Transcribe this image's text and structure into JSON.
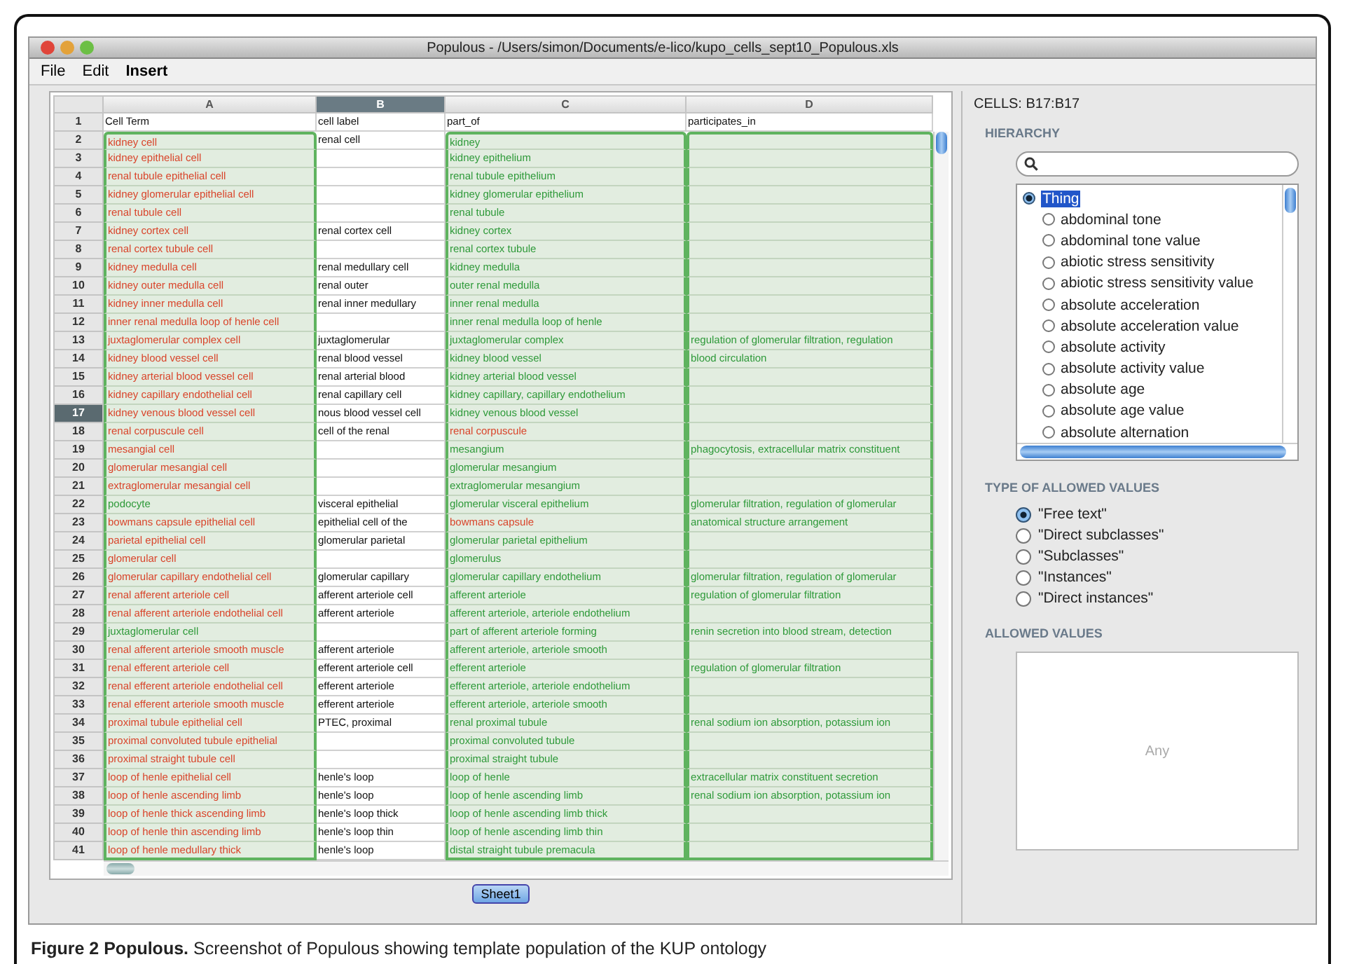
{
  "window": {
    "title": "Populous - /Users/simon/Documents/e-lico/kupo_cells_sept10_Populous.xls"
  },
  "menu": [
    "File",
    "Edit",
    "Insert"
  ],
  "table": {
    "columns": [
      {
        "label": "A",
        "selected": false,
        "highlighted": true
      },
      {
        "label": "B",
        "selected": true,
        "highlighted": false
      },
      {
        "label": "C",
        "selected": false,
        "highlighted": true
      },
      {
        "label": "D",
        "selected": false,
        "highlighted": true
      }
    ],
    "header_row": {
      "number": "1",
      "cells": [
        {
          "text": "Cell Term"
        },
        {
          "text": "cell label"
        },
        {
          "text": "part_of"
        },
        {
          "text": "participates_in"
        }
      ]
    },
    "rows": [
      {
        "number": "2",
        "selected": false,
        "cells": [
          {
            "text": "kidney cell",
            "color": "#d9452b"
          },
          {
            "text": "renal cell"
          },
          {
            "text": "kidney",
            "color": "#2f9a3a"
          },
          null
        ]
      },
      {
        "number": "3",
        "selected": false,
        "cells": [
          {
            "text": "kidney epithelial cell",
            "color": "#d9452b"
          },
          null,
          {
            "text": "kidney epithelium",
            "color": "#2f9a3a"
          },
          null
        ]
      },
      {
        "number": "4",
        "selected": false,
        "cells": [
          {
            "text": "renal tubule epithelial cell",
            "color": "#d9452b"
          },
          null,
          {
            "text": "renal tubule epithelium",
            "color": "#2f9a3a"
          },
          null
        ]
      },
      {
        "number": "5",
        "selected": false,
        "cells": [
          {
            "text": "kidney glomerular epithelial cell",
            "color": "#d9452b"
          },
          null,
          {
            "text": "kidney glomerular epithelium",
            "color": "#2f9a3a"
          },
          null
        ]
      },
      {
        "number": "6",
        "selected": false,
        "cells": [
          {
            "text": "renal tubule cell",
            "color": "#d9452b"
          },
          null,
          {
            "text": "renal tubule",
            "color": "#2f9a3a"
          },
          null
        ]
      },
      {
        "number": "7",
        "selected": false,
        "cells": [
          {
            "text": "kidney cortex cell",
            "color": "#d9452b"
          },
          {
            "text": "renal cortex cell"
          },
          {
            "text": "kidney cortex",
            "color": "#2f9a3a"
          },
          null
        ]
      },
      {
        "number": "8",
        "selected": false,
        "cells": [
          {
            "text": "renal cortex tubule cell",
            "color": "#d9452b"
          },
          null,
          {
            "text": "renal cortex tubule",
            "color": "#2f9a3a"
          },
          null
        ]
      },
      {
        "number": "9",
        "selected": false,
        "cells": [
          {
            "text": "kidney medulla cell",
            "color": "#d9452b"
          },
          {
            "text": "renal medullary cell"
          },
          {
            "text": "kidney medulla",
            "color": "#2f9a3a"
          },
          null
        ]
      },
      {
        "number": "10",
        "selected": false,
        "cells": [
          {
            "text": "kidney outer medulla cell",
            "color": "#d9452b"
          },
          {
            "text": "renal outer"
          },
          {
            "text": "outer renal medulla",
            "color": "#2f9a3a"
          },
          null
        ]
      },
      {
        "number": "11",
        "selected": false,
        "cells": [
          {
            "text": "kidney inner medulla cell",
            "color": "#d9452b"
          },
          {
            "text": "renal inner medullary"
          },
          {
            "text": "inner renal medulla",
            "color": "#2f9a3a"
          },
          null
        ]
      },
      {
        "number": "12",
        "selected": false,
        "cells": [
          {
            "text": "inner renal medulla loop of henle cell",
            "color": "#d9452b"
          },
          null,
          {
            "text": "inner renal medulla loop of henle",
            "color": "#2f9a3a"
          },
          null
        ]
      },
      {
        "number": "13",
        "selected": false,
        "cells": [
          {
            "text": "juxtaglomerular complex cell",
            "color": "#d9452b"
          },
          {
            "text": "juxtaglomerular"
          },
          {
            "text": "juxtaglomerular complex",
            "color": "#2f9a3a"
          },
          {
            "text": "regulation of glomerular filtration, regulation",
            "color": "#2f9a3a"
          }
        ]
      },
      {
        "number": "14",
        "selected": false,
        "cells": [
          {
            "text": "kidney blood vessel cell",
            "color": "#d9452b"
          },
          {
            "text": "renal blood vessel"
          },
          {
            "text": "kidney blood vessel",
            "color": "#2f9a3a"
          },
          {
            "text": "blood circulation",
            "color": "#2f9a3a"
          }
        ]
      },
      {
        "number": "15",
        "selected": false,
        "cells": [
          {
            "text": "kidney arterial blood vessel cell",
            "color": "#d9452b"
          },
          {
            "text": "renal arterial blood"
          },
          {
            "text": "kidney arterial blood vessel",
            "color": "#2f9a3a"
          },
          null
        ]
      },
      {
        "number": "16",
        "selected": false,
        "cells": [
          {
            "text": "kidney capillary endothelial cell",
            "color": "#d9452b"
          },
          {
            "text": "renal capillary cell"
          },
          {
            "text": "kidney capillary, capillary endothelium",
            "color": "#2f9a3a"
          },
          null
        ]
      },
      {
        "number": "17",
        "selected": true,
        "cells": [
          {
            "text": "kidney venous blood vessel cell",
            "color": "#d9452b"
          },
          {
            "text": "nous blood vessel cell"
          },
          {
            "text": "kidney venous blood vessel",
            "color": "#2f9a3a"
          },
          null
        ]
      },
      {
        "number": "18",
        "selected": false,
        "cells": [
          {
            "text": "renal corpuscule cell",
            "color": "#d9452b"
          },
          {
            "text": "cell of the renal"
          },
          {
            "text": "renal corpuscule",
            "color": "#d9452b"
          },
          null
        ]
      },
      {
        "number": "19",
        "selected": false,
        "cells": [
          {
            "text": "mesangial cell",
            "color": "#d9452b"
          },
          null,
          {
            "text": "mesangium",
            "color": "#2f9a3a"
          },
          {
            "text": "phagocytosis, extracellular matrix constituent",
            "color": "#2f9a3a"
          }
        ]
      },
      {
        "number": "20",
        "selected": false,
        "cells": [
          {
            "text": "glomerular mesangial cell",
            "color": "#d9452b"
          },
          null,
          {
            "text": "glomerular mesangium",
            "color": "#2f9a3a"
          },
          null
        ]
      },
      {
        "number": "21",
        "selected": false,
        "cells": [
          {
            "text": "extraglomerular mesangial cell",
            "color": "#d9452b"
          },
          null,
          {
            "text": "extraglomerular mesangium",
            "color": "#2f9a3a"
          },
          null
        ]
      },
      {
        "number": "22",
        "selected": false,
        "cells": [
          {
            "text": "podocyte",
            "color": "#2f9a3a"
          },
          {
            "text": "visceral epithelial"
          },
          {
            "text": "glomerular visceral epithelium",
            "color": "#2f9a3a"
          },
          {
            "text": "glomerular filtration, regulation of glomerular",
            "color": "#2f9a3a"
          }
        ]
      },
      {
        "number": "23",
        "selected": false,
        "cells": [
          {
            "text": "bowmans capsule epithelial cell",
            "color": "#d9452b"
          },
          {
            "text": "epithelial cell of the"
          },
          {
            "text": "bowmans capsule",
            "color": "#d9452b"
          },
          {
            "text": "anatomical structure arrangement",
            "color": "#2f9a3a"
          }
        ]
      },
      {
        "number": "24",
        "selected": false,
        "cells": [
          {
            "text": "parietal epithelial cell",
            "color": "#d9452b"
          },
          {
            "text": "glomerular parietal"
          },
          {
            "text": "glomerular parietal epithelium",
            "color": "#2f9a3a"
          },
          null
        ]
      },
      {
        "number": "25",
        "selected": false,
        "cells": [
          {
            "text": "glomerular cell",
            "color": "#d9452b"
          },
          null,
          {
            "text": "glomerulus",
            "color": "#2f9a3a"
          },
          null
        ]
      },
      {
        "number": "26",
        "selected": false,
        "cells": [
          {
            "text": "glomerular capillary endothelial cell",
            "color": "#d9452b"
          },
          {
            "text": "glomerular capillary"
          },
          {
            "text": "glomerular capillary endothelium",
            "color": "#2f9a3a"
          },
          {
            "text": "glomerular filtration, regulation of glomerular",
            "color": "#2f9a3a"
          }
        ]
      },
      {
        "number": "27",
        "selected": false,
        "cells": [
          {
            "text": "renal afferent arteriole cell",
            "color": "#d9452b"
          },
          {
            "text": "afferent arteriole cell"
          },
          {
            "text": "afferent arteriole",
            "color": "#2f9a3a"
          },
          {
            "text": "regulation of glomerular filtration",
            "color": "#2f9a3a"
          }
        ]
      },
      {
        "number": "28",
        "selected": false,
        "cells": [
          {
            "text": "renal afferent arteriole endothelial cell",
            "color": "#d9452b"
          },
          {
            "text": "afferent arteriole"
          },
          {
            "text": "afferent arteriole, arteriole endothelium",
            "color": "#2f9a3a"
          },
          null
        ]
      },
      {
        "number": "29",
        "selected": false,
        "cells": [
          {
            "text": "juxtaglomerular cell",
            "color": "#2f9a3a"
          },
          null,
          {
            "text": "part of afferent arteriole forming",
            "color": "#2f9a3a"
          },
          {
            "text": "renin secretion into blood stream, detection",
            "color": "#2f9a3a"
          }
        ]
      },
      {
        "number": "30",
        "selected": false,
        "cells": [
          {
            "text": "renal afferent arteriole smooth muscle",
            "color": "#d9452b"
          },
          {
            "text": "afferent arteriole"
          },
          {
            "text": "afferent arteriole, arteriole smooth",
            "color": "#2f9a3a"
          },
          null
        ]
      },
      {
        "number": "31",
        "selected": false,
        "cells": [
          {
            "text": "renal efferent arteriole cell",
            "color": "#d9452b"
          },
          {
            "text": "efferent arteriole cell"
          },
          {
            "text": "efferent arteriole",
            "color": "#2f9a3a"
          },
          {
            "text": "regulation of glomerular filtration",
            "color": "#2f9a3a"
          }
        ]
      },
      {
        "number": "32",
        "selected": false,
        "cells": [
          {
            "text": "renal efferent arteriole endothelial cell",
            "color": "#d9452b"
          },
          {
            "text": "efferent arteriole"
          },
          {
            "text": "efferent arteriole, arteriole endothelium",
            "color": "#2f9a3a"
          },
          null
        ]
      },
      {
        "number": "33",
        "selected": false,
        "cells": [
          {
            "text": "renal efferent arteriole smooth muscle",
            "color": "#d9452b"
          },
          {
            "text": "efferent arteriole"
          },
          {
            "text": "efferent arteriole, arteriole smooth",
            "color": "#2f9a3a"
          },
          null
        ]
      },
      {
        "number": "34",
        "selected": false,
        "cells": [
          {
            "text": "proximal tubule epithelial cell",
            "color": "#d9452b"
          },
          {
            "text": "PTEC, proximal"
          },
          {
            "text": "renal proximal tubule",
            "color": "#2f9a3a"
          },
          {
            "text": "renal sodium ion absorption, potassium ion",
            "color": "#2f9a3a"
          }
        ]
      },
      {
        "number": "35",
        "selected": false,
        "cells": [
          {
            "text": "proximal convoluted tubule epithelial",
            "color": "#d9452b"
          },
          null,
          {
            "text": "proximal convoluted tubule",
            "color": "#2f9a3a"
          },
          null
        ]
      },
      {
        "number": "36",
        "selected": false,
        "cells": [
          {
            "text": "proximal straight tubule cell",
            "color": "#d9452b"
          },
          null,
          {
            "text": "proximal straight tubule",
            "color": "#2f9a3a"
          },
          null
        ]
      },
      {
        "number": "37",
        "selected": false,
        "cells": [
          {
            "text": "loop of henle epithelial cell",
            "color": "#d9452b"
          },
          {
            "text": "henle's loop"
          },
          {
            "text": "loop of henle",
            "color": "#2f9a3a"
          },
          {
            "text": "extracellular matrix constituent secretion",
            "color": "#2f9a3a"
          }
        ]
      },
      {
        "number": "38",
        "selected": false,
        "cells": [
          {
            "text": "loop of henle ascending limb",
            "color": "#d9452b"
          },
          {
            "text": "henle's loop"
          },
          {
            "text": "loop of henle ascending limb",
            "color": "#2f9a3a"
          },
          {
            "text": "renal sodium ion absorption, potassium ion",
            "color": "#2f9a3a"
          }
        ]
      },
      {
        "number": "39",
        "selected": false,
        "cells": [
          {
            "text": "loop of henle thick ascending limb",
            "color": "#d9452b"
          },
          {
            "text": "henle's loop thick"
          },
          {
            "text": "loop of henle ascending limb thick",
            "color": "#2f9a3a"
          },
          null
        ]
      },
      {
        "number": "40",
        "selected": false,
        "cells": [
          {
            "text": "loop of henle thin ascending limb",
            "color": "#d9452b"
          },
          {
            "text": "henle's loop thin"
          },
          {
            "text": "loop of henle ascending limb thin",
            "color": "#2f9a3a"
          },
          null
        ]
      },
      {
        "number": "41",
        "selected": false,
        "cells": [
          {
            "text": "loop of henle medullary thick",
            "color": "#d9452b"
          },
          {
            "text": "henle's loop"
          },
          {
            "text": "distal straight tubule premacula",
            "color": "#2f9a3a"
          },
          null
        ]
      }
    ]
  },
  "sheet_tabs": [
    {
      "label": "Sheet1",
      "selected": true
    }
  ],
  "side_panel": {
    "cells_label": "CELLS: B17:B17",
    "hierarchy_heading": "HIERARCHY",
    "tree": [
      {
        "label": "Thing",
        "selected": true,
        "children": [
          {
            "label": "abdominal tone",
            "selected": false
          },
          {
            "label": "abdominal tone value",
            "selected": false
          },
          {
            "label": "abiotic stress sensitivity",
            "selected": false
          },
          {
            "label": "abiotic stress sensitivity value",
            "selected": false
          },
          {
            "label": "absolute acceleration",
            "selected": false
          },
          {
            "label": "absolute acceleration value",
            "selected": false
          },
          {
            "label": "absolute activity",
            "selected": false
          },
          {
            "label": "absolute activity value",
            "selected": false
          },
          {
            "label": "absolute age",
            "selected": false
          },
          {
            "label": "absolute age value",
            "selected": false
          },
          {
            "label": "absolute alternation",
            "selected": false
          }
        ]
      }
    ],
    "type_heading": "TYPE OF ALLOWED VALUES",
    "type_options": [
      {
        "label": "\"Free text\"",
        "selected": true
      },
      {
        "label": "\"Direct subclasses\"",
        "selected": false
      },
      {
        "label": "\"Subclasses\"",
        "selected": false
      },
      {
        "label": "\"Instances\"",
        "selected": false
      },
      {
        "label": "\"Direct instances\"",
        "selected": false
      }
    ],
    "allowed_heading": "ALLOWED VALUES",
    "allowed_placeholder": "Any"
  },
  "caption": "**Figure 2 Populous.** Screenshot of Populous showing template population of the KUP ontology"
}
